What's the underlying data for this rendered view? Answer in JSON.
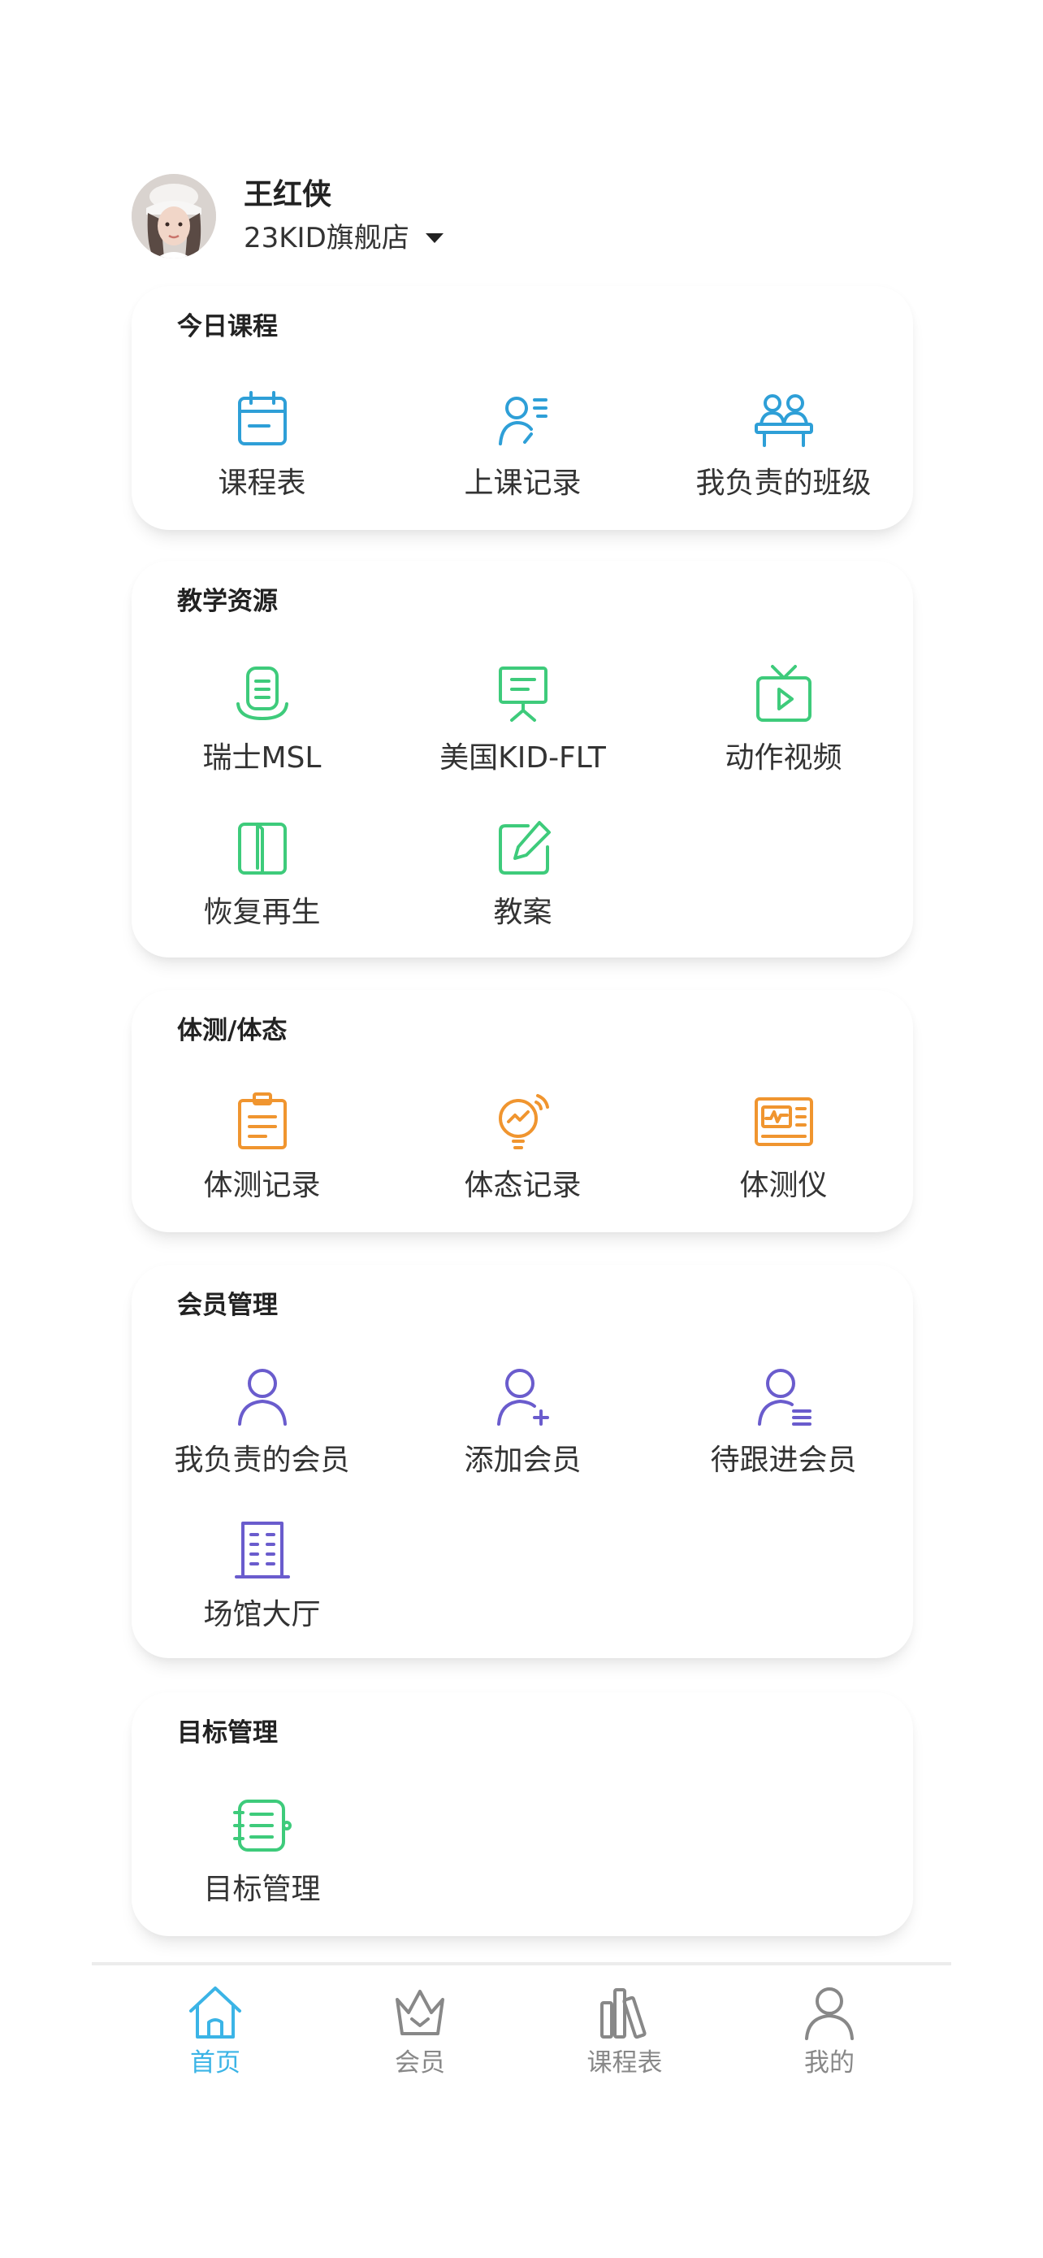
{
  "user": {
    "name": "王红侠",
    "store": "23KID旗舰店"
  },
  "colors": {
    "blue": "#2e9fd7",
    "green": "#3ecb7b",
    "orange": "#f0952f",
    "purple": "#6a5ccd",
    "tab_active": "#3bb4e6",
    "tab_inactive": "#888888"
  },
  "sections": {
    "today": {
      "title": "今日课程",
      "items": [
        {
          "label": "课程表",
          "icon": "calendar-icon"
        },
        {
          "label": "上课记录",
          "icon": "teacher-record-icon"
        },
        {
          "label": "我负责的班级",
          "icon": "class-group-icon"
        }
      ]
    },
    "resources": {
      "title": "教学资源",
      "items": [
        {
          "label": "瑞士MSL",
          "icon": "document-stand-icon"
        },
        {
          "label": "美国KID-FLT",
          "icon": "presentation-board-icon"
        },
        {
          "label": "动作视频",
          "icon": "tv-play-icon"
        },
        {
          "label": "恢复再生",
          "icon": "open-book-icon"
        },
        {
          "label": "教案",
          "icon": "edit-note-icon"
        }
      ]
    },
    "body_test": {
      "title": "体测/体态",
      "items": [
        {
          "label": "体测记录",
          "icon": "clipboard-list-icon"
        },
        {
          "label": "体态记录",
          "icon": "bulb-chart-icon"
        },
        {
          "label": "体测仪",
          "icon": "monitor-device-icon"
        }
      ]
    },
    "members": {
      "title": "会员管理",
      "items": [
        {
          "label": "我负责的会员",
          "icon": "person-icon"
        },
        {
          "label": "添加会员",
          "icon": "person-add-icon"
        },
        {
          "label": "待跟进会员",
          "icon": "person-list-icon"
        },
        {
          "label": "场馆大厅",
          "icon": "building-icon"
        }
      ]
    },
    "goals": {
      "title": "目标管理",
      "items": [
        {
          "label": "目标管理",
          "icon": "target-list-icon"
        }
      ]
    }
  },
  "tabbar": {
    "tabs": [
      {
        "label": "首页",
        "icon": "home-icon",
        "active": true
      },
      {
        "label": "会员",
        "icon": "crown-icon",
        "active": false
      },
      {
        "label": "课程表",
        "icon": "books-icon",
        "active": false
      },
      {
        "label": "我的",
        "icon": "profile-icon",
        "active": false
      }
    ]
  }
}
